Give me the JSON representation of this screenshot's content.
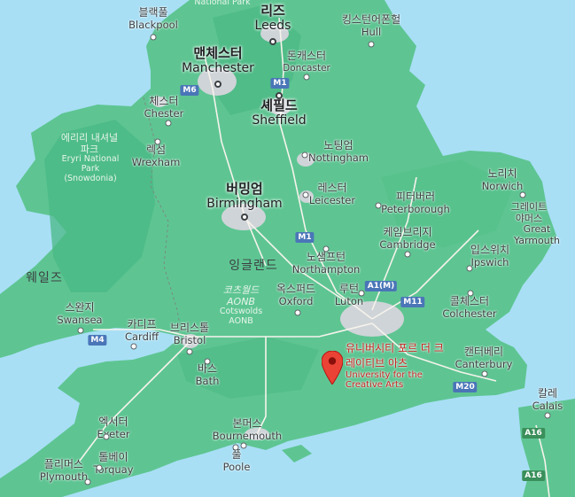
{
  "map": {
    "cities_major": [
      {
        "id": "leeds",
        "ko": "리즈",
        "en": "Leeds"
      },
      {
        "id": "manchester",
        "ko": "맨체스터",
        "en": "Manchester"
      },
      {
        "id": "sheffield",
        "ko": "셰필드",
        "en": "Sheffield"
      },
      {
        "id": "birmingham",
        "ko": "버밍엄",
        "en": "Birmingham"
      }
    ],
    "cities": [
      {
        "id": "blackpool",
        "ko": "블랙풀",
        "en": "Blackpool"
      },
      {
        "id": "hull",
        "ko": "킹스턴어폰헐",
        "en": "Hull"
      },
      {
        "id": "doncaster",
        "ko": "돈캐스터",
        "en": "Doncaster"
      },
      {
        "id": "chester",
        "ko": "체스터",
        "en": "Chester"
      },
      {
        "id": "wrexham",
        "ko": "렉섬",
        "en": "Wrexham"
      },
      {
        "id": "nottingham",
        "ko": "노팅엄",
        "en": "Nottingham"
      },
      {
        "id": "leicester",
        "ko": "레스터",
        "en": "Leicester"
      },
      {
        "id": "norwich",
        "ko": "노리치",
        "en": "Norwich"
      },
      {
        "id": "peterborough",
        "ko": "피터버러",
        "en": "Peterborough"
      },
      {
        "id": "great_yarmouth",
        "ko": "그레이트 야머스",
        "en": "Great Yarmouth"
      },
      {
        "id": "cambridge",
        "ko": "케임브리지",
        "en": "Cambridge"
      },
      {
        "id": "ipswich",
        "ko": "입스위치",
        "en": "Ipswich"
      },
      {
        "id": "northampton",
        "ko": "노샘프턴",
        "en": "Northampton"
      },
      {
        "id": "oxford",
        "ko": "옥스퍼드",
        "en": "Oxford"
      },
      {
        "id": "luton",
        "ko": "루턴",
        "en": "Luton"
      },
      {
        "id": "colchester",
        "ko": "콜체스터",
        "en": "Colchester"
      },
      {
        "id": "swansea",
        "ko": "스완지",
        "en": "Swansea"
      },
      {
        "id": "cardiff",
        "ko": "카디프",
        "en": "Cardiff"
      },
      {
        "id": "bristol",
        "ko": "브리스톨",
        "en": "Bristol"
      },
      {
        "id": "bath",
        "ko": "바스",
        "en": "Bath"
      },
      {
        "id": "canterbury",
        "ko": "캔터베리",
        "en": "Canterbury"
      },
      {
        "id": "calais",
        "ko": "칼레",
        "en": "Calais"
      },
      {
        "id": "exeter",
        "ko": "엑서터",
        "en": "Exeter"
      },
      {
        "id": "bournemouth",
        "ko": "본머스",
        "en": "Bournemouth"
      },
      {
        "id": "poole",
        "ko": "풀",
        "en": "Poole"
      },
      {
        "id": "torquay",
        "ko": "톨베이",
        "en": "Torquay"
      },
      {
        "id": "plymouth",
        "ko": "플리머스",
        "en": "Plymouth"
      }
    ],
    "parks": [
      {
        "id": "national_park_top",
        "en": "National Park"
      },
      {
        "id": "eryri",
        "ko": "에리리 내셔널 파크",
        "en": "Eryri National Park (Snowdonia)"
      },
      {
        "id": "cotswolds",
        "ko": "코츠월드 AONB",
        "en": "Cotswolds AONB"
      }
    ],
    "regions": [
      {
        "id": "wales",
        "ko": "웨일즈"
      },
      {
        "id": "england",
        "ko": "잉글랜드"
      }
    ],
    "roads": [
      "M6",
      "M1",
      "M1",
      "A1(M)",
      "M11",
      "M4",
      "M20",
      "A16",
      "A16"
    ],
    "poi": {
      "ko": "유니버시티 포르 더 크레이티브 아츠",
      "en": "University for the Creative Arts"
    },
    "colors": {
      "sea": "#a8dff5",
      "land": "#5ec592",
      "land_dark": "#4ab884",
      "urban": "#d5d8dc",
      "pin": "#ea4335"
    }
  }
}
